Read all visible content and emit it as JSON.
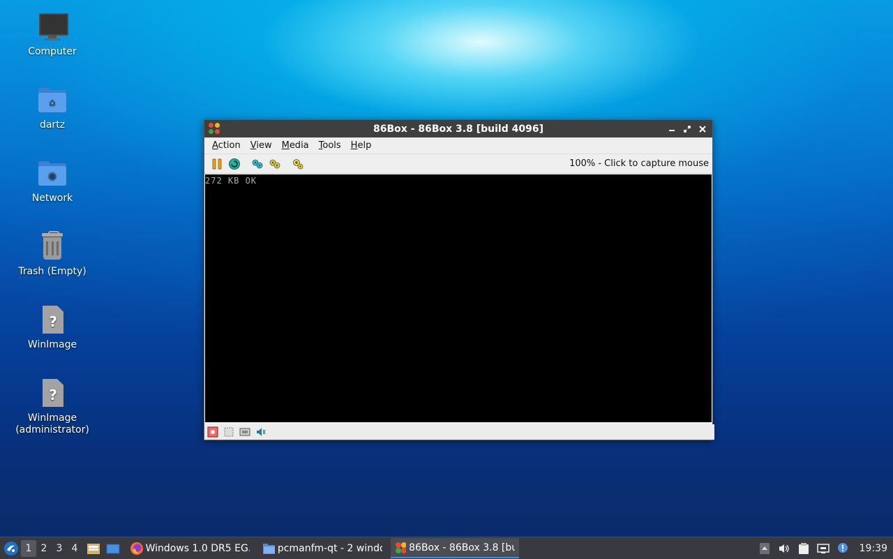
{
  "desktop": {
    "icons": [
      {
        "label": "Computer"
      },
      {
        "label": "dartz"
      },
      {
        "label": "Network"
      },
      {
        "label": "Trash (Empty)"
      },
      {
        "label": "WinImage"
      },
      {
        "label": "WinImage (administrator)"
      }
    ]
  },
  "window": {
    "title": "86Box - 86Box 3.8 [build 4096]",
    "menu": [
      {
        "label": "Action",
        "mnemonic": "A",
        "rest": "ction"
      },
      {
        "label": "View",
        "mnemonic": "V",
        "rest": "iew"
      },
      {
        "label": "Media",
        "mnemonic": "M",
        "rest": "edia"
      },
      {
        "label": "Tools",
        "mnemonic": "T",
        "rest": "ools"
      },
      {
        "label": "Help",
        "mnemonic": "H",
        "rest": "elp"
      }
    ],
    "status_text": "100% - Click to capture mouse",
    "screen_text": "272 KB OK"
  },
  "taskbar": {
    "desktops": [
      "1",
      "2",
      "3",
      "4"
    ],
    "active_desktop": "1",
    "tasks": [
      {
        "label": "Windows 1.0 DR5 EG..."
      },
      {
        "label": "pcmanfm-qt - 2 windo..."
      },
      {
        "label": "86Box - 86Box 3.8 [bu..."
      }
    ],
    "clock": "19:39"
  },
  "colors": {
    "accent": "#3d8ee6",
    "titlebar": "#3f3f3f",
    "taskbar": "#383a3f"
  }
}
